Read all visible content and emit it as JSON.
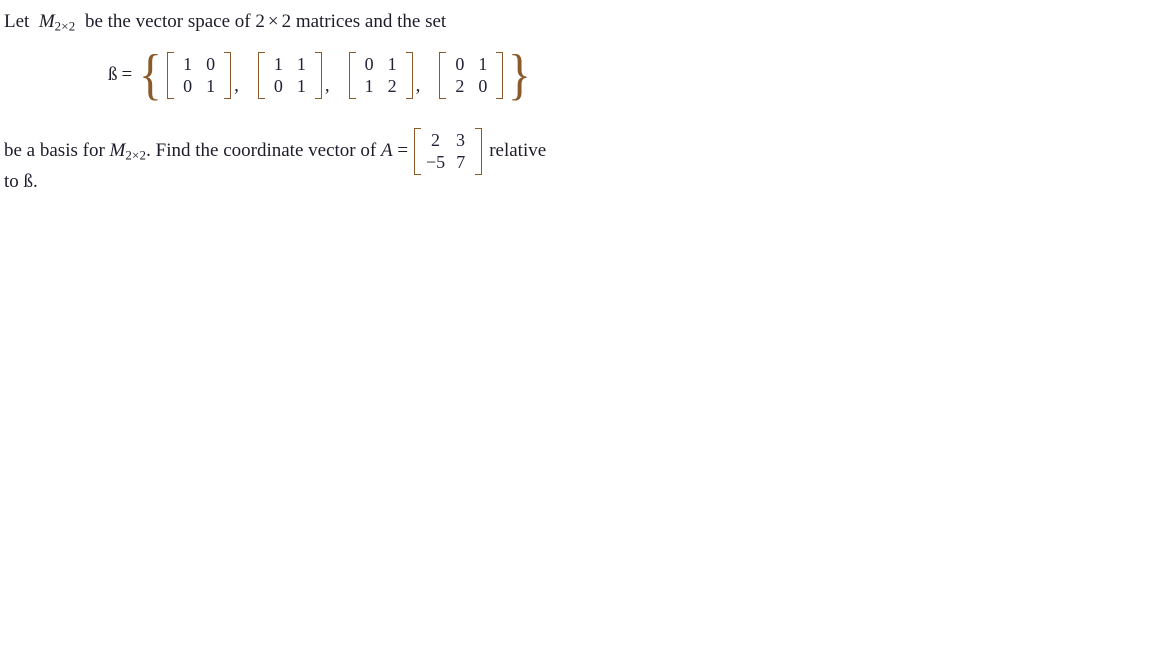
{
  "document": {
    "background_color": "#ffffff",
    "text_color": "#1c1c2a",
    "bracket_color": "#8a5a2b",
    "line1": {
      "part1": "Let",
      "space_name": "M",
      "space_sub": "2×2",
      "part2": "be the vector space of 2",
      "times": "×",
      "part3": "2 matrices and the set"
    },
    "equation": {
      "basis_label": "ß",
      "equals": "=",
      "open_brace": "{",
      "close_brace": "}",
      "separator": ",",
      "matrices": [
        {
          "rows": [
            [
              "1",
              "0"
            ],
            [
              "0",
              "1"
            ]
          ]
        },
        {
          "rows": [
            [
              "1",
              "1"
            ],
            [
              "0",
              "1"
            ]
          ]
        },
        {
          "rows": [
            [
              "0",
              "1"
            ],
            [
              "1",
              "2"
            ]
          ]
        },
        {
          "rows": [
            [
              "0",
              "1"
            ],
            [
              "2",
              "0"
            ]
          ]
        }
      ]
    },
    "line3": {
      "part1": "be a basis for",
      "space_name": "M",
      "space_sub": "2×2",
      "part2": ". Find the coordinate vector of",
      "matrix_name": "A",
      "equals": "=",
      "matrix_a": {
        "rows": [
          [
            "2",
            "3"
          ],
          [
            "−5",
            "7"
          ]
        ]
      },
      "part3": "relative"
    },
    "line4": {
      "part1": "to",
      "basis_label": "ß",
      "period": "."
    }
  }
}
